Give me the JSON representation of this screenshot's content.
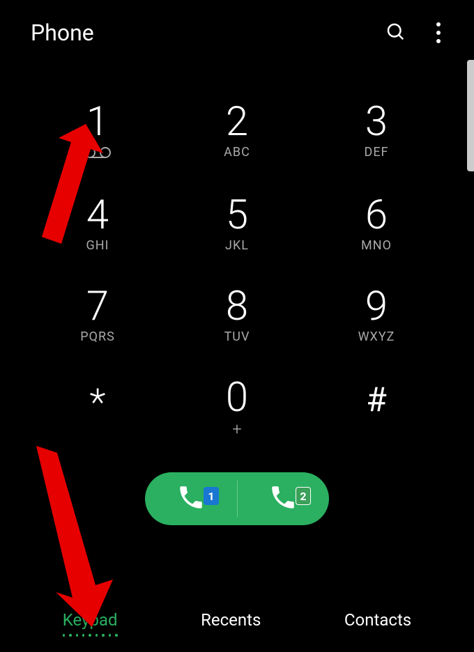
{
  "header": {
    "title": "Phone"
  },
  "keypad": {
    "keys": [
      {
        "digit": "1",
        "sub": "",
        "voicemail": true
      },
      {
        "digit": "2",
        "sub": "ABC"
      },
      {
        "digit": "3",
        "sub": "DEF"
      },
      {
        "digit": "4",
        "sub": "GHI"
      },
      {
        "digit": "5",
        "sub": "JKL"
      },
      {
        "digit": "6",
        "sub": "MNO"
      },
      {
        "digit": "7",
        "sub": "PQRS"
      },
      {
        "digit": "8",
        "sub": "TUV"
      },
      {
        "digit": "9",
        "sub": "WXYZ"
      },
      {
        "digit": "*",
        "sub": ""
      },
      {
        "digit": "0",
        "sub": "+"
      },
      {
        "digit": "#",
        "sub": ""
      }
    ]
  },
  "call": {
    "sim1": "1",
    "sim2": "2"
  },
  "tabs": {
    "keypad": "Keypad",
    "recents": "Recents",
    "contacts": "Contacts",
    "active": "keypad"
  },
  "colors": {
    "accent": "#2ab060",
    "sim1": "#1976d2",
    "sim2": "#3aa05a",
    "arrow": "#e60000"
  }
}
